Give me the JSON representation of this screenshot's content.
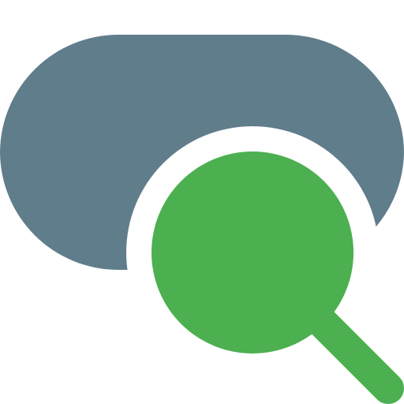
{
  "icon": {
    "name": "toggle-search-icon",
    "colors": {
      "background": "#ffffff",
      "pill": "#607D8B",
      "lens": "#4CAF50",
      "handle": "#4CAF50",
      "cutout": "#ffffff"
    }
  }
}
